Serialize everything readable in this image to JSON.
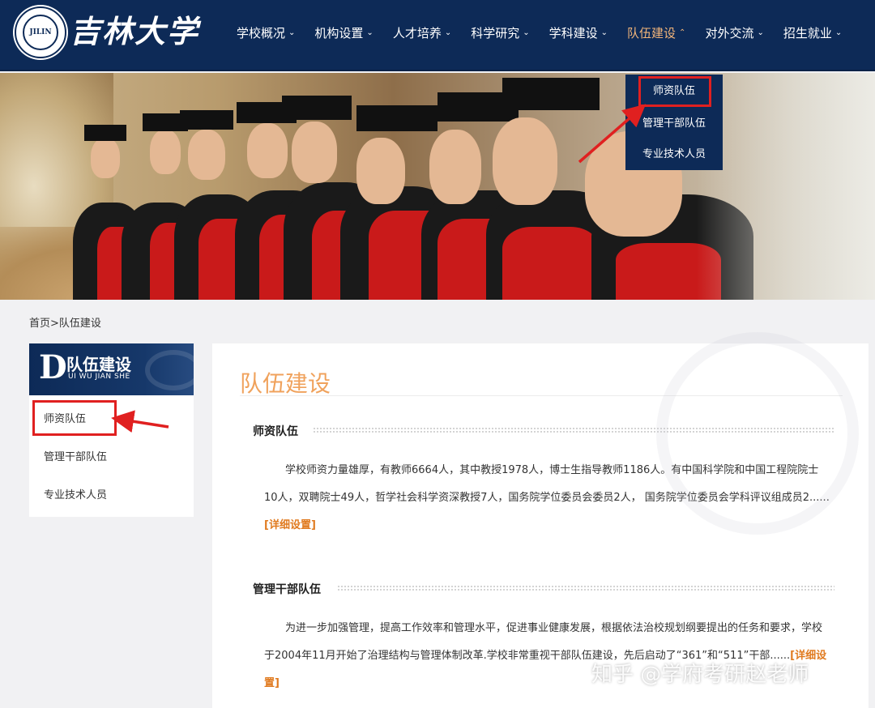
{
  "header": {
    "logo_text": "吉林大学",
    "logo_seal_text": "JILIN",
    "nav": [
      {
        "label": "学校概况"
      },
      {
        "label": "机构设置"
      },
      {
        "label": "人才培养"
      },
      {
        "label": "科学研究"
      },
      {
        "label": "学科建设"
      },
      {
        "label": "队伍建设",
        "active": true
      },
      {
        "label": "对外交流"
      },
      {
        "label": "招生就业"
      }
    ],
    "dropdown": [
      "师资队伍",
      "管理干部队伍",
      "专业技术人员"
    ]
  },
  "breadcrumb": "首页>队伍建设",
  "sidebar": {
    "head_letter": "D",
    "head_title": "队伍建设",
    "head_pinyin": "UI WU JIAN SHE",
    "items": [
      "师资队伍",
      "管理干部队伍",
      "专业技术人员"
    ]
  },
  "content": {
    "title": "队伍建设",
    "sections": [
      {
        "title": "师资队伍",
        "text": "学校师资力量雄厚，有教师6664人，其中教授1978人，博士生指导教师1186人。有中国科学院和中国工程院院士10人，双聘院士49人，哲学社会科学资深教授7人，国务院学位委员会委员2人， 国务院学位委员会学科评议组成员2......",
        "more": "[详细设置]"
      },
      {
        "title": "管理干部队伍",
        "text": "为进一步加强管理，提高工作效率和管理水平，促进事业健康发展，根据依法治校规划纲要提出的任务和要求，学校于2004年11月开始了治理结构与管理体制改革.学校非常重视干部队伍建设，先后启动了“361”和“511”干部......",
        "more": "[详细设置]"
      }
    ]
  },
  "watermark": "知乎 @学府考研赵老师",
  "colors": {
    "navy": "#0d2a57",
    "accent_orange": "#f0a25c",
    "highlight_red": "#e02020",
    "link_orange": "#e07a1f"
  }
}
